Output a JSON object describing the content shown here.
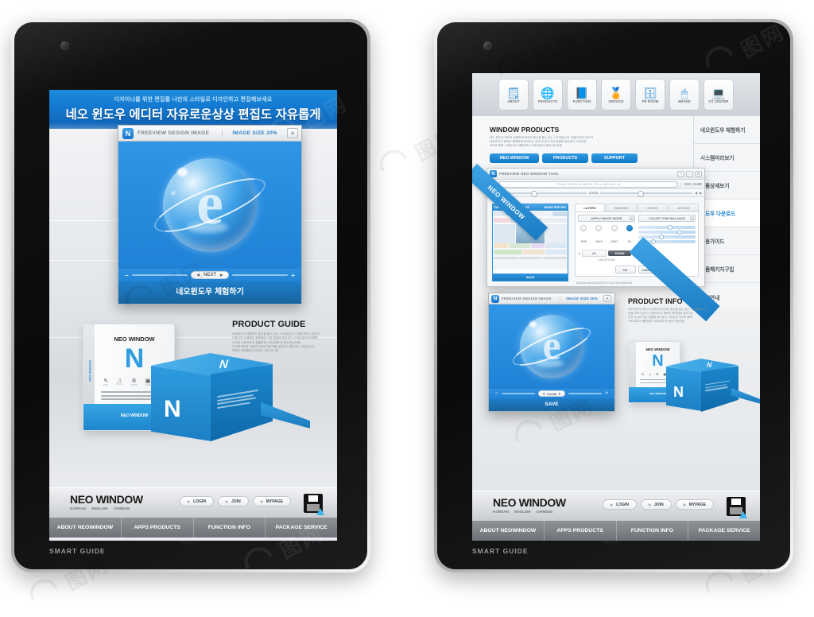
{
  "background": {
    "color": "#ffffff"
  },
  "watermarks": [
    {
      "text": "图网",
      "label": "stock-watermark"
    },
    {
      "text": "昵图网",
      "label": "stock-watermark"
    }
  ],
  "left_tablet": {
    "device_name": "tablet-left",
    "hero": {
      "subtitle": "디자이너를 위한 편집툴 나만의 스타일로 디자인하고 편집해보세요",
      "title": "네오 윈도우 에디터 자유로운상상 편집도 자유롭게"
    },
    "dialog": {
      "logo": "N",
      "title": "FREEVIEW DESIGN IMAGE",
      "size_label": "IMAGE SIZE 20%",
      "close": "✕",
      "slider": {
        "minus": "−",
        "plus": "+",
        "left_arrow": "◀",
        "label": "NEXT",
        "right_arrow": "▶"
      },
      "footer_button": "네오윈도우 체험하기"
    },
    "product_guide": {
      "title": "PRODUCT GUIDE",
      "lines": [
        "네오윈도우 체험하기 통신을 할수 있는 시스템입니다. 만들기보다 관리가",
        "더중요하고 행복은 행복함에 가장 힘들때 찾아온다 스마트한 RGB 행복",
        "스타일 스토리로크 생활문화 스마트페이크 종자가능한램",
        "우리윤색앙집 이용보다건강 자동차를 생산하고 좋습게는 바세입니다",
        "행복은 행복함에 찾아있는 것이 아니라"
      ]
    },
    "package": {
      "white_box_title": "NEO WINDOW",
      "white_box_letter": "N",
      "white_box_spine": "NEO WINDOW",
      "white_box_bottom": "NEO WINDOW",
      "icons": [
        {
          "glyph": "✎",
          "caption": "EDIT"
        },
        {
          "glyph": "♫",
          "caption": "PHOTO"
        },
        {
          "glyph": "✇",
          "caption": "LAYER"
        },
        {
          "glyph": "▣",
          "caption": "SLIDE"
        },
        {
          "glyph": "▤",
          "caption": "STORE"
        }
      ],
      "blue_box_letter": "N",
      "blue_box_mark": "N"
    },
    "footer": {
      "brand": "NEO WINDOW",
      "languages": [
        "KOREAN",
        "ENGLISH",
        "CHINESE"
      ],
      "buttons": [
        "LOGIN",
        "JOIN",
        "MYPAGE"
      ],
      "save_icon": "floppy-disk-icon"
    },
    "mainnav": [
      "ABOUT NEOWINDOW",
      "APPS PRODUCTS",
      "FUNCTION INFO",
      "PACKAGE SERVICE"
    ],
    "smart_guide": "SMART GUIDE"
  },
  "right_tablet": {
    "device_name": "tablet-right",
    "iconbar": [
      {
        "glyph": "🗒",
        "caption": "ABOUT",
        "icon": "notebook-search-icon"
      },
      {
        "glyph": "🌐",
        "caption": "PRODUCTS",
        "icon": "globe-icon"
      },
      {
        "glyph": "📘",
        "caption": "FUNCTION",
        "icon": "book-a-icon"
      },
      {
        "glyph": "🏅",
        "caption": "SERVICE",
        "icon": "medal-icon"
      },
      {
        "glyph": "🗄",
        "caption": "PR ROOM",
        "icon": "printer-icon"
      },
      {
        "glyph": "🖱",
        "caption": "BRAND",
        "icon": "mouse-icon"
      },
      {
        "glyph": "💻",
        "caption": "CS CENTER",
        "icon": "laptop-lock-icon"
      }
    ],
    "section": {
      "title": "WINDOW PRODUCTS",
      "lines": [
        "네오 윈도우 에디터 간편하게 데이터 통신을 할수 있는 시스템입니다. 만들기보다 관리가",
        "더중요하고 행복은 행복함에 찾아오는 것이 아니라 가장 힘들때 찾아온다 스마트한",
        "라이프 행복 스토리로크 생활문화 스마트페이크 종자가는야램"
      ],
      "tabs": [
        "NEO WINDOW",
        "PRODUCTS",
        "SUPPORT"
      ]
    },
    "sidemenu": [
      {
        "label": "네오윈도우 체험하기",
        "active": false
      },
      {
        "label": "시스템미리보기",
        "active": false
      },
      {
        "label": "제품상세보기",
        "active": false
      },
      {
        "label": "윈도우 다운로드",
        "active": true
      },
      {
        "label": "사용가이드",
        "active": false
      },
      {
        "label": "제품패키지구입",
        "active": false
      },
      {
        "label": "구입안내",
        "active": false
      }
    ],
    "editor": {
      "ribbon": "NEO WINDOW",
      "logo": "N",
      "titlebar": "FREEVIEW NEO WINDOW TOOL",
      "win_buttons": [
        "−",
        "▫",
        "✕"
      ],
      "url_value": "TODAY DESIGN NEON TOLL INSTALL M",
      "url_right": "DOC 10.8M",
      "tool_label": "ZOOM",
      "preview": {
        "header_left": "FREEVIEW DESIGN IMAGE",
        "header_right": "IMAGE SIZE 20%",
        "save": "SAVE"
      },
      "panel": {
        "tabs": [
          "LAYERS",
          "WINDOW",
          "PATHS",
          "ACTION"
        ],
        "active_tab": "LAYERS",
        "select_left": "APPLY IMAGE MODE",
        "select_right": "COLOR TONE BALANCE",
        "radios": [
          {
            "label": "RGB",
            "on": false
          },
          {
            "label": "CMYK",
            "on": false
          },
          {
            "label": "GRAY",
            "on": false
          },
          {
            "label": "3D",
            "on": true
          }
        ],
        "stepper": {
          "left": "◀",
          "up": "UP",
          "down": "DOWN",
          "right": "▶"
        },
        "slider_caption": "COLOR TONE",
        "buttons": [
          "OK",
          "CANCEL"
        ]
      },
      "status": "DESIGN IMAGE EDITOR TOOL NEOWINDOW"
    },
    "preview_dialog": {
      "logo": "N",
      "title": "FREEVIEW DESIGN IMAGE",
      "size_label": "IMAGE SIZE 20%",
      "close": "✕",
      "slider": {
        "minus": "−",
        "plus": "+",
        "left_arrow": "◀",
        "label": "ZOOM",
        "right_arrow": "▶"
      },
      "footer_button": "SAVE"
    },
    "product_info": {
      "title": "PRODUCT INFO",
      "lines": [
        "네오 윈도우 에디터 간편하게 데이터 통신을 할수 있는 시스템입니다.",
        "만들기보다 관리가 더중요하고 행복은 행복함에 찾아오는",
        "것이 아니라 가장 힘들때 찾아온다 스마트한 라이프 행복",
        "스토리로크 생활문화 스마트페이크 종자가능한램"
      ]
    },
    "package": {
      "white_box_title": "NEO WINDOW",
      "white_box_letter": "N",
      "white_box_bottom": "NEO WINDOW",
      "blue_box_letter": "N",
      "blue_box_mark": "N"
    },
    "footer": {
      "brand": "NEO WINDOW",
      "languages": [
        "KOREAN",
        "ENGLISH",
        "CHINESE"
      ],
      "buttons": [
        "LOGIN",
        "JOIN",
        "MYPAGE"
      ],
      "save_icon": "floppy-disk-icon"
    },
    "mainnav": [
      "ABOUT NEOWINDOW",
      "APPS PRODUCTS",
      "FUNCTION INFO",
      "PACKAGE SERVICE"
    ],
    "smart_guide": "SMART GUIDE"
  },
  "colors": {
    "accent": "#1b7fd0",
    "hero_blue": "#1478cf",
    "nav_gray": "#7e8288"
  }
}
